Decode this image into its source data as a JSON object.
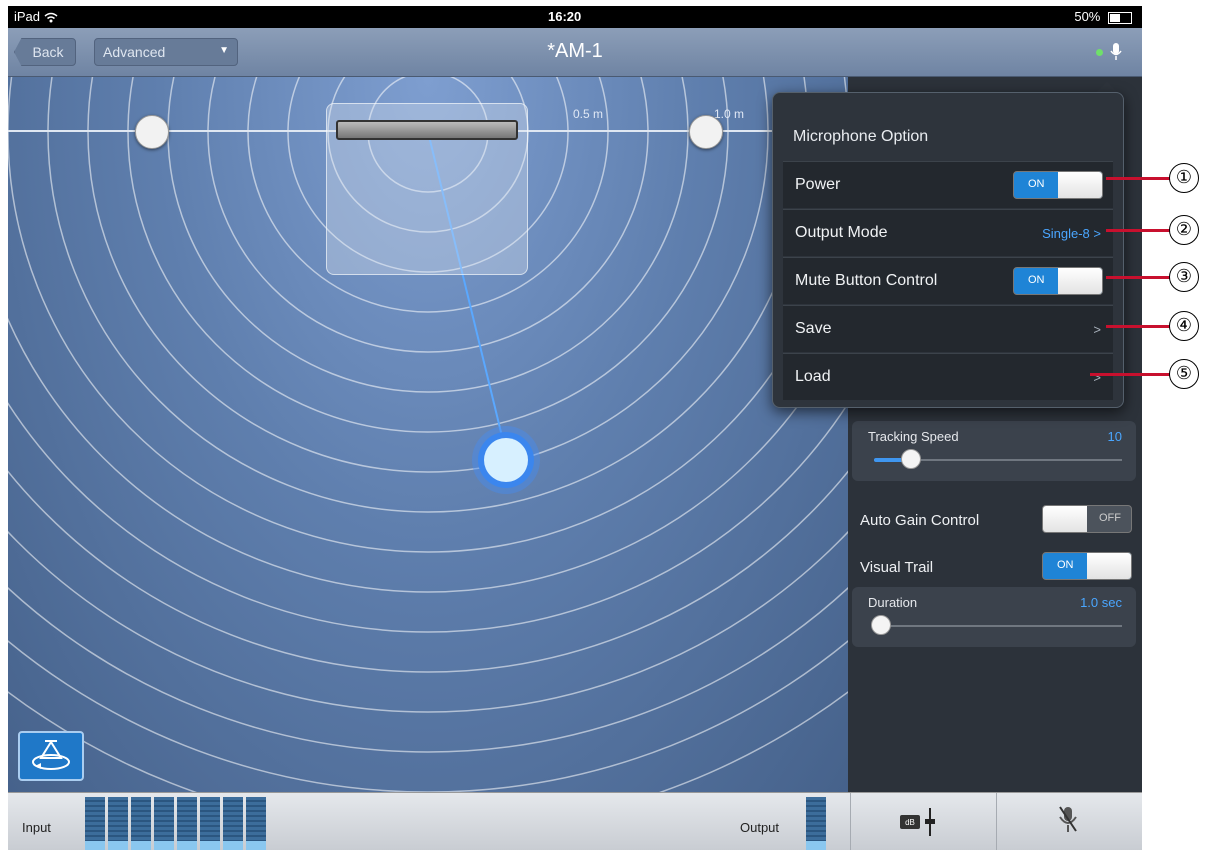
{
  "status_bar": {
    "device": "iPad",
    "wifi_icon": "wifi-icon",
    "time": "16:20",
    "battery": "50%"
  },
  "nav": {
    "back_label": "Back",
    "mode_label": "Advanced",
    "title": "*AM-1"
  },
  "stage": {
    "dist_half": "0.5 m",
    "dist_one": "1.0 m"
  },
  "panel": {
    "tracking_speed": {
      "label": "Tracking Speed",
      "value": "10",
      "level": 0.15
    },
    "auto_gain": {
      "label": "Auto Gain Control",
      "state": "OFF"
    },
    "visual_trail": {
      "label": "Visual Trail",
      "state": "ON"
    },
    "duration": {
      "label": "Duration",
      "value": "1.0 sec",
      "level": 0.03
    }
  },
  "popover": {
    "title": "Microphone Option",
    "power": {
      "label": "Power",
      "state": "ON"
    },
    "output_mode": {
      "label": "Output Mode",
      "value": "Single-8 >"
    },
    "mute_control": {
      "label": "Mute Button Control",
      "state": "ON"
    },
    "save": {
      "label": "Save",
      "chevron": ">"
    },
    "load": {
      "label": "Load",
      "chevron": ">"
    }
  },
  "callouts": [
    "①",
    "②",
    "③",
    "④",
    "⑤"
  ],
  "bottom": {
    "input_label": "Input",
    "output_label": "Output",
    "db_label": "dB"
  },
  "colors": {
    "accent": "#1f84d6",
    "callout": "#c8102e"
  }
}
